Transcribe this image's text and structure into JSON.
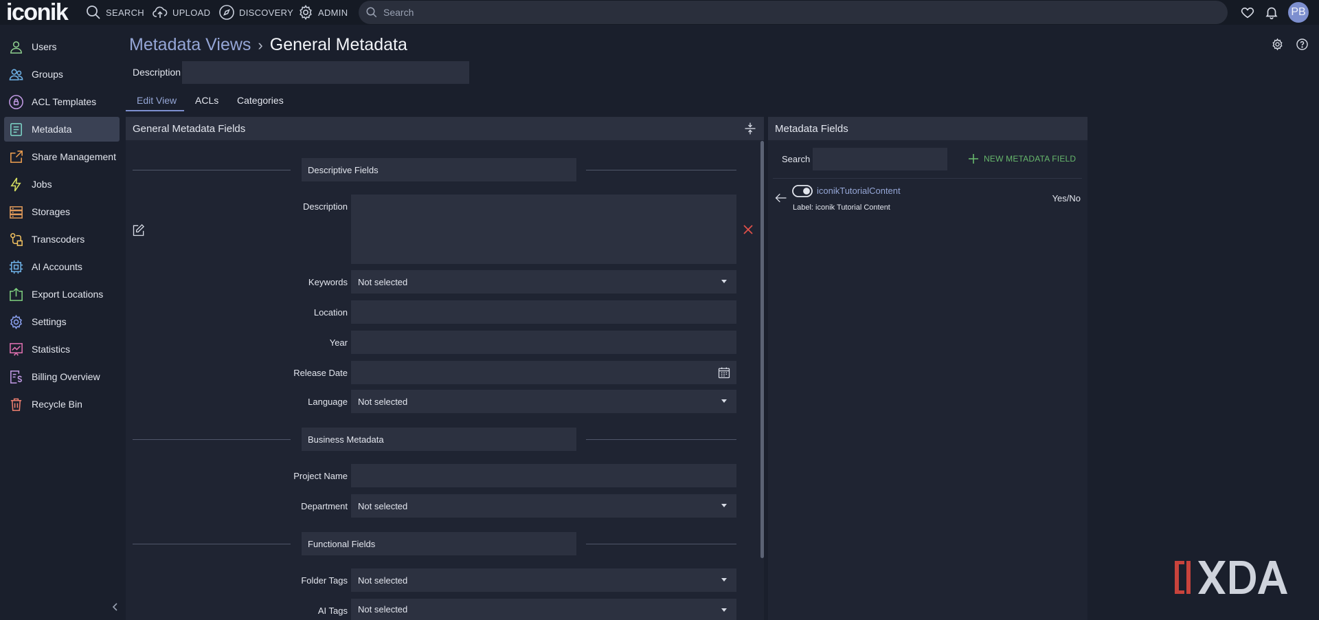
{
  "app": {
    "logo": "iconik"
  },
  "topnav": {
    "items": [
      {
        "label": "SEARCH",
        "icon": "search-icon"
      },
      {
        "label": "UPLOAD",
        "icon": "cloud-upload-icon"
      },
      {
        "label": "DISCOVERY",
        "icon": "compass-icon"
      },
      {
        "label": "ADMIN",
        "icon": "gear-icon"
      }
    ],
    "search_placeholder": "Search",
    "avatar_initials": "PB"
  },
  "sidebar": {
    "items": [
      {
        "label": "Users",
        "icon": "user-icon",
        "color": "#8fd08f"
      },
      {
        "label": "Groups",
        "icon": "users-icon",
        "color": "#6fb3e8"
      },
      {
        "label": "ACL Templates",
        "icon": "lock-badge-icon",
        "color": "#c39be6"
      },
      {
        "label": "Metadata",
        "icon": "document-icon",
        "color": "#7ed6c8",
        "active": true
      },
      {
        "label": "Share Management",
        "icon": "share-icon",
        "color": "#f0a050"
      },
      {
        "label": "Jobs",
        "icon": "lightning-icon",
        "color": "#d6e060"
      },
      {
        "label": "Storages",
        "icon": "storage-icon",
        "color": "#e09a5a"
      },
      {
        "label": "Transcoders",
        "icon": "transcoder-icon",
        "color": "#f0c060"
      },
      {
        "label": "AI Accounts",
        "icon": "chip-icon",
        "color": "#6fb3e8"
      },
      {
        "label": "Export Locations",
        "icon": "export-icon",
        "color": "#7fd07f"
      },
      {
        "label": "Settings",
        "icon": "gear-icon",
        "color": "#8aa0f0"
      },
      {
        "label": "Statistics",
        "icon": "chart-icon",
        "color": "#e070b0"
      },
      {
        "label": "Billing Overview",
        "icon": "billing-icon",
        "color": "#c39be6"
      },
      {
        "label": "Recycle Bin",
        "icon": "trash-icon",
        "color": "#f08070"
      }
    ]
  },
  "header": {
    "breadcrumb_parent": "Metadata Views",
    "breadcrumb_separator": "›",
    "title": "General Metadata",
    "description_label": "Description",
    "description_value": ""
  },
  "tabs": [
    {
      "label": "Edit View",
      "active": true
    },
    {
      "label": "ACLs"
    },
    {
      "label": "Categories"
    }
  ],
  "left_panel": {
    "title": "General Metadata Fields",
    "sections": [
      {
        "title": "Descriptive Fields"
      },
      {
        "title": "Business Metadata"
      },
      {
        "title": "Functional Fields"
      }
    ],
    "fields": [
      {
        "label": "Description",
        "value": "",
        "type": "textarea"
      },
      {
        "label": "Keywords",
        "value": "Not selected",
        "type": "select"
      },
      {
        "label": "Location",
        "value": "",
        "type": "text"
      },
      {
        "label": "Year",
        "value": "",
        "type": "text"
      },
      {
        "label": "Release Date",
        "value": "",
        "type": "date"
      },
      {
        "label": "Language",
        "value": "Not selected",
        "type": "select"
      },
      {
        "label": "Project Name",
        "value": "",
        "type": "text"
      },
      {
        "label": "Department",
        "value": "Not selected",
        "type": "select"
      },
      {
        "label": "Folder Tags",
        "value": "Not selected",
        "type": "select"
      },
      {
        "label": "AI Tags",
        "value": "Not selected",
        "type": "select"
      }
    ]
  },
  "right_panel": {
    "title": "Metadata Fields",
    "search_label": "Search",
    "search_value": "",
    "new_field_label": "NEW METADATA FIELD",
    "fields": [
      {
        "name": "iconikTutorialContent",
        "label": "Label: iconik Tutorial Content",
        "type": "Yes/No"
      }
    ]
  },
  "colors": {
    "accent": "#95a6d6",
    "positive": "#67b86c",
    "danger": "#e0504a",
    "background": "#1a1f2c",
    "panel": "#2c3140"
  }
}
